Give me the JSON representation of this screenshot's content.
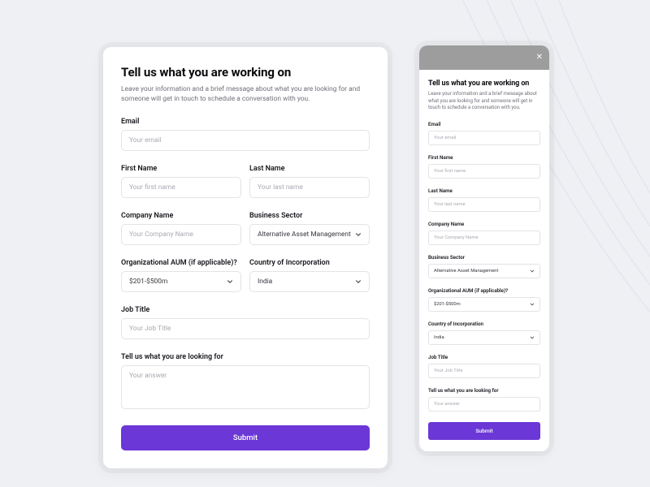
{
  "header": {
    "title": "Tell us what you are working on",
    "subtitle": "Leave your information and a brief message about what you are looking for and someone will get in touch to schedule a conversation with you."
  },
  "fields": {
    "email": {
      "label": "Email",
      "placeholder": "Your email"
    },
    "firstName": {
      "label": "First Name",
      "placeholder": "Your first name"
    },
    "lastName": {
      "label": "Last Name",
      "placeholder": "Your last name"
    },
    "companyName": {
      "label": "Company Name",
      "placeholder": "Your Company Name"
    },
    "businessSector": {
      "label": "Business Sector",
      "value": "Alternative Asset Management"
    },
    "aum": {
      "label": "Organizational AUM (if applicable)?",
      "value": "$201-$500m"
    },
    "country": {
      "label": "Country of Incorporation",
      "value": "India"
    },
    "jobTitle": {
      "label": "Job Title",
      "placeholder": "Your Job Title"
    },
    "lookingFor": {
      "label": "Tell us what you are looking for",
      "placeholder": "Your answer"
    }
  },
  "submit": "Submit",
  "closeIcon": "✕"
}
